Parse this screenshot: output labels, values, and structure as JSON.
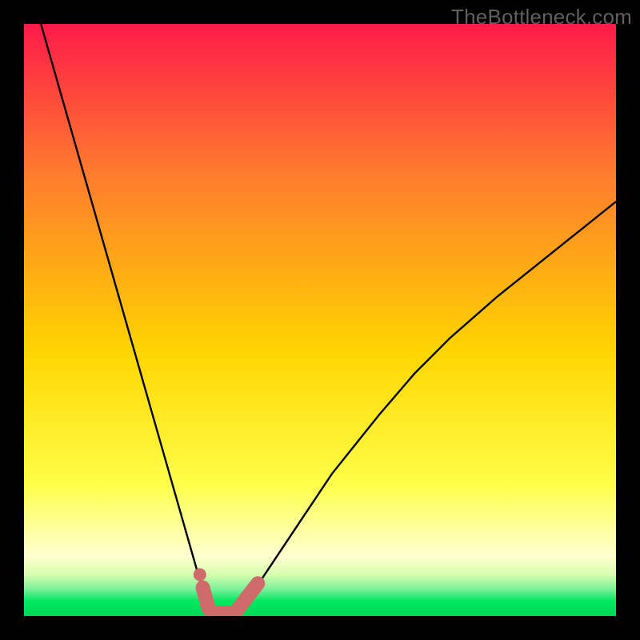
{
  "watermark": "TheBottleneck.com",
  "colors": {
    "black": "#000000",
    "grad_top": "#ff1a49",
    "grad_mid_upper": "#ff7a2e",
    "grad_mid": "#ffd400",
    "grad_low": "#ffff6a",
    "grad_pale": "#ffffaa",
    "grad_green": "#00e860",
    "curve": "#000000",
    "marker": "#cf6b6b"
  },
  "chart_data": {
    "type": "line",
    "title": "",
    "xlabel": "",
    "ylabel": "",
    "xlim": [
      0,
      100
    ],
    "ylim": [
      0,
      100
    ],
    "series": [
      {
        "name": "bottleneck-curve",
        "x": [
          0,
          2,
          4,
          6,
          8,
          10,
          12,
          14,
          16,
          18,
          20,
          22,
          24,
          26,
          28,
          30,
          31,
          32,
          33,
          34,
          35,
          36,
          38,
          40,
          44,
          48,
          52,
          56,
          60,
          66,
          72,
          80,
          90,
          100
        ],
        "y": [
          110,
          103,
          96,
          89,
          82,
          75,
          68,
          61,
          54,
          47,
          40,
          33,
          26,
          19,
          12,
          5,
          3,
          1,
          0,
          0,
          0,
          1,
          3,
          6,
          12,
          18,
          24,
          29,
          34,
          41,
          47,
          54,
          62,
          70
        ]
      }
    ],
    "markers": [
      {
        "name": "left-marker-dot",
        "x": 29.7,
        "y": 7.0
      },
      {
        "name": "left-marker-seg",
        "x0": 30.2,
        "y0": 4.8,
        "x1": 31.2,
        "y1": 1.2
      },
      {
        "name": "floor-seg",
        "x0": 31.8,
        "y0": 0.5,
        "x1": 35.2,
        "y1": 0.5
      },
      {
        "name": "right-marker-seg",
        "x0": 36.0,
        "y0": 1.0,
        "x1": 39.5,
        "y1": 5.5
      }
    ],
    "gradient_stops": [
      {
        "offset": 0.0,
        "color": "#ff1a49"
      },
      {
        "offset": 0.25,
        "color": "#ff7a2e"
      },
      {
        "offset": 0.55,
        "color": "#ffd400"
      },
      {
        "offset": 0.78,
        "color": "#ffff4a"
      },
      {
        "offset": 0.86,
        "color": "#ffffaa"
      },
      {
        "offset": 0.9,
        "color": "#ffffd0"
      },
      {
        "offset": 0.93,
        "color": "#d7ffad"
      },
      {
        "offset": 0.955,
        "color": "#7af09a"
      },
      {
        "offset": 0.975,
        "color": "#00e860"
      },
      {
        "offset": 1.0,
        "color": "#00d858"
      }
    ]
  }
}
